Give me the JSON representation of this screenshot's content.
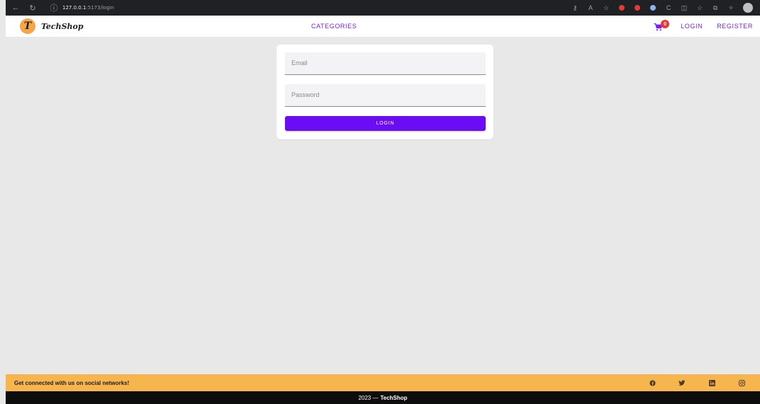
{
  "browser": {
    "url_host": "127.0.0.1",
    "url_rest": ":5173/login"
  },
  "navbar": {
    "brand_initial": "T",
    "brand_name": "TechShop",
    "categories_label": "CATEGORIES",
    "cart_count": "0",
    "login_label": "LOGIN",
    "register_label": "REGISTER"
  },
  "login_form": {
    "email_label": "Email",
    "password_label": "Password",
    "submit_label": "LOGIN"
  },
  "footer": {
    "social_text": "Get connected with us on social networks!",
    "social_icons": [
      "facebook-icon",
      "twitter-icon",
      "linkedin-icon",
      "instagram-icon"
    ],
    "copyright_year": "2023 —",
    "copyright_brand": "TechShop"
  },
  "colors": {
    "accent": "#7a1fff",
    "button": "#6a0df5",
    "footer_bar": "#f7b54e",
    "footer_bottom": "#0d0d0d",
    "logo": "#f6a547",
    "badge": "#e53935"
  }
}
